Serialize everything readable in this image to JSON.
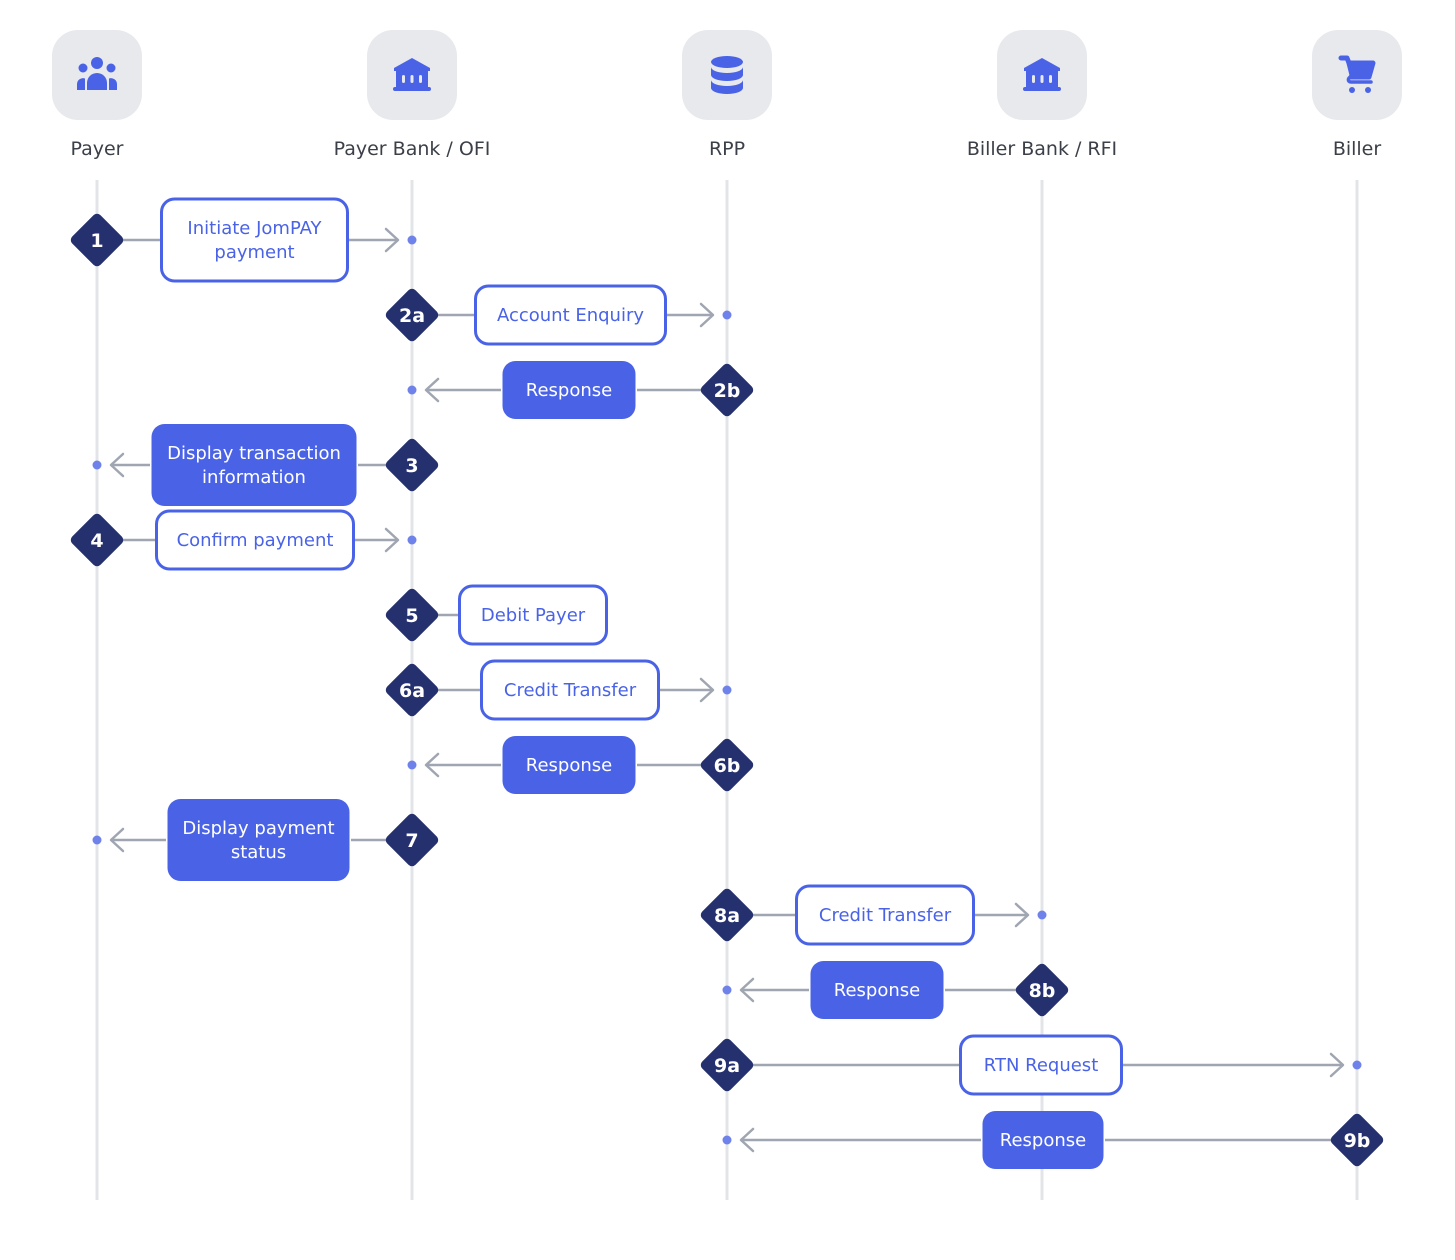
{
  "actors": [
    {
      "label": "Payer",
      "icon": "people-icon"
    },
    {
      "label": "Payer Bank / OFI",
      "icon": "bank-icon"
    },
    {
      "label": "RPP",
      "icon": "database-icon"
    },
    {
      "label": "Biller Bank / RFI",
      "icon": "bank-icon"
    },
    {
      "label": "Biller",
      "icon": "cart-icon"
    }
  ],
  "steps": [
    {
      "number": "1",
      "lines": [
        "Initiate JomPAY",
        "payment"
      ],
      "from": 0,
      "to": 1,
      "style": "outline"
    },
    {
      "number": "2a",
      "lines": [
        "Account Enquiry"
      ],
      "from": 1,
      "to": 2,
      "style": "outline"
    },
    {
      "number": "2b",
      "lines": [
        "Response"
      ],
      "from": 2,
      "to": 1,
      "style": "filled"
    },
    {
      "number": "3",
      "lines": [
        "Display transaction",
        "information"
      ],
      "from": 1,
      "to": 0,
      "style": "filled"
    },
    {
      "number": "4",
      "lines": [
        "Confirm payment"
      ],
      "from": 0,
      "to": 1,
      "style": "outline"
    },
    {
      "number": "5",
      "lines": [
        "Debit Payer"
      ],
      "from": 1,
      "to": null,
      "style": "outline"
    },
    {
      "number": "6a",
      "lines": [
        "Credit Transfer"
      ],
      "from": 1,
      "to": 2,
      "style": "outline"
    },
    {
      "number": "6b",
      "lines": [
        "Response"
      ],
      "from": 2,
      "to": 1,
      "style": "filled"
    },
    {
      "number": "7",
      "lines": [
        "Display payment",
        "status"
      ],
      "from": 1,
      "to": 0,
      "style": "filled"
    },
    {
      "number": "8a",
      "lines": [
        "Credit Transfer"
      ],
      "from": 2,
      "to": 3,
      "style": "outline"
    },
    {
      "number": "8b",
      "lines": [
        "Response"
      ],
      "from": 3,
      "to": 2,
      "style": "filled"
    },
    {
      "number": "9a",
      "lines": [
        "RTN Request"
      ],
      "from": 2,
      "to": 4,
      "style": "outline"
    },
    {
      "number": "9b",
      "lines": [
        "Response"
      ],
      "from": 4,
      "to": 2,
      "style": "filled"
    }
  ],
  "colors": {
    "accent": "#4a63e6",
    "badge": "#25306f",
    "connector": "#a0a6b1",
    "lifeline": "#e3e4e8",
    "icon_bg": "#e8e9ed"
  }
}
